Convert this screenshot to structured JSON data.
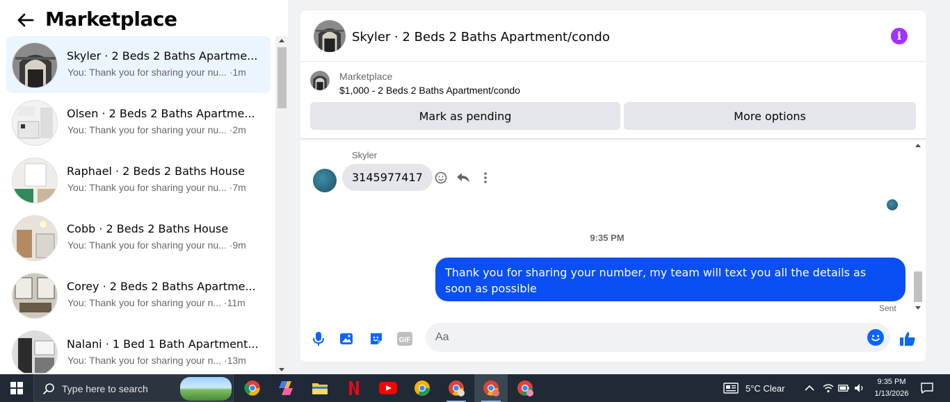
{
  "left": {
    "title": "Marketplace",
    "conversations": [
      {
        "name": "Skyler · 2 Beds 2 Baths Apartme...",
        "preview": "You: Thank you for sharing your nu...",
        "time": "·1m",
        "active": true
      },
      {
        "name": "Olsen · 2 Beds 2 Baths Apartme...",
        "preview": "You: Thank you for sharing your nu...",
        "time": "·2m"
      },
      {
        "name": "Raphael · 2 Beds 2 Baths House",
        "preview": "You: Thank you for sharing your nu...",
        "time": "·7m"
      },
      {
        "name": "Cobb · 2 Beds 2 Baths House",
        "preview": "You: Thank you for sharing your nu...",
        "time": "·9m"
      },
      {
        "name": "Corey · 2 Beds 2 Baths Apartme...",
        "preview": "You: Thank you for sharing your n...",
        "time": "·11m"
      },
      {
        "name": "Nalani · 1 Bed 1 Bath Apartment...",
        "preview": "You: Thank you for sharing your n...",
        "time": "·13m"
      }
    ]
  },
  "chat": {
    "title": "Skyler · 2 Beds 2 Baths Apartment/condo",
    "listing": {
      "source": "Marketplace",
      "title": "$1,000 - 2 Beds 2 Baths Apartment/condo",
      "pending_label": "Mark as pending",
      "more_label": "More options"
    },
    "incoming": {
      "sender": "Skyler",
      "text": "3145977417"
    },
    "timestamp": "9:35 PM",
    "outgoing": {
      "text": "Thank you for  sharing your number, my team will text you all the details as soon as possible",
      "status": "Sent"
    },
    "composer_placeholder": "Aa"
  },
  "taskbar": {
    "search_placeholder": "Type here to search",
    "weather": "5°C  Clear",
    "time": "9:35 PM",
    "date": "1/13/2026"
  },
  "colors": {
    "accent": "#0866ff",
    "outgoing_bubble": "#0a4ff3",
    "info": "#a033ff",
    "active_conv": "#ebf5ff"
  }
}
